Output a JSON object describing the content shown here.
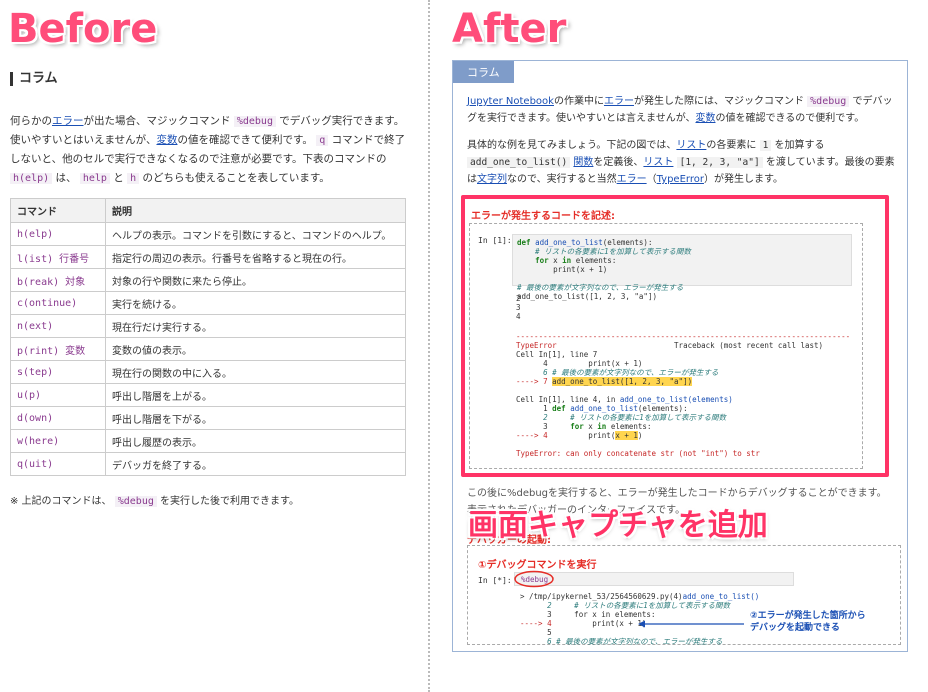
{
  "labels": {
    "before": "Before",
    "after": "After",
    "overlay": "画面キャプチャを追加"
  },
  "left": {
    "title": "コラム",
    "para1": {
      "t1": "何らかの",
      "l1": "エラー",
      "t2": "が出た場合、マジックコマンド ",
      "c1": "%debug",
      "t3": " でデバッグ実行できます。使いやすいとはいえませんが、",
      "l2": "変数",
      "t4": "の値を確認できて便利です。 ",
      "c2": "q",
      "t5": " コマンドで終了しないと、他のセルで実行できなくなるので注意が必要です。下表のコマンドの ",
      "c3": "h(elp)",
      "t6": " は、 ",
      "c4": "help",
      "t7": " と ",
      "c5": "h",
      "t8": " のどちらも使えることを表しています。"
    },
    "table": {
      "headers": [
        "コマンド",
        "説明"
      ],
      "rows": [
        [
          "h(elp)",
          "ヘルプの表示。コマンドを引数にすると、コマンドのヘルプ。"
        ],
        [
          "l(ist) 行番号",
          "指定行の周辺の表示。行番号を省略すると現在の行。"
        ],
        [
          "b(reak) 対象",
          "対象の行や関数に来たら停止。"
        ],
        [
          "c(ontinue)",
          "実行を続ける。"
        ],
        [
          "n(ext)",
          "現在行だけ実行する。"
        ],
        [
          "p(rint) 変数",
          "変数の値の表示。"
        ],
        [
          "s(tep)",
          "現在行の関数の中に入る。"
        ],
        [
          "u(p)",
          "呼出し階層を上がる。"
        ],
        [
          "d(own)",
          "呼出し階層を下がる。"
        ],
        [
          "w(here)",
          "呼出し履歴の表示。"
        ],
        [
          "q(uit)",
          "デバッガを終了する。"
        ]
      ]
    },
    "note": {
      "t1": "※ 上記のコマンドは、 ",
      "c1": "%debug",
      "t2": " を実行した後で利用できます。"
    }
  },
  "right": {
    "tab": "コラム",
    "para1": {
      "l1": "Jupyter Notebook",
      "t1": "の作業中に",
      "l2": "エラー",
      "t2": "が発生した際には、マジックコマンド ",
      "c1": "%debug",
      "t3": " でデバッグを実行できます。使いやすいとは言えませんが、",
      "l3": "変数",
      "t4": "の値を確認できるので便利です。"
    },
    "para2": {
      "t1": "具体的な例を見てみましょう。下記の図では、",
      "l1": "リスト",
      "t2": "の各要素に ",
      "c1": "1",
      "t3": " を加算する ",
      "c2": "add_one_to_list()",
      "t4": " ",
      "l2": "関数",
      "t5": "を定義後、",
      "l3": "リスト",
      "t6": " ",
      "c3": "[1, 2, 3, \"a\"]",
      "t7": " を渡しています。最後の要素は",
      "l4": "文字列",
      "t8": "なので、実行すると当然",
      "l5": "エラー",
      "t9": "（",
      "l6": "TypeError",
      "t10": "）が発生します。"
    },
    "redbox_title": "エラーが発生するコードを記述:",
    "in1": "In [1]:",
    "code": {
      "l1a": "def ",
      "l1b": "add_one_to_list",
      "l1c": "(elements):",
      "l2": "    # リストの各要素に1を加算して表示する関数",
      "l3a": "    ",
      "l3b": "for",
      "l3c": " x ",
      "l3d": "in",
      "l3e": " elements:",
      "l4": "        print(x + 1)",
      "l6": "# 最後の要素が文字列なので、エラーが発生する",
      "l7": "add_one_to_list([1, 2, 3, \"a\"])"
    },
    "out": [
      "2",
      "3",
      "4"
    ],
    "tb": {
      "sep": "--------------------------------------------------------------------------",
      "type": "TypeError",
      "recent": "Traceback (most recent call last)",
      "cell1": "Cell In[1], line 7",
      "a4": "      4         print(x + 1)",
      "a6": "      6 # 最後の要素が文字列なので、エラーが発生する",
      "a7p": "----> 7 ",
      "a7h": "add_one_to_list([1, 2, 3, \"a\"])",
      "cell2a": "Cell In[1], line 4, in ",
      "cell2b": "add_one_to_list(elements)",
      "b1a": "      1 ",
      "b1b": "def ",
      "b1c": "add_one_to_list",
      "b1d": "(elements):",
      "b2": "      2     # リストの各要素に1を加算して表示する関数",
      "b3a": "      3     ",
      "b3b": "for",
      "b3c": " x ",
      "b3d": "in",
      "b3e": " elements:",
      "b4p": "----> 4         ",
      "b4a": "print(",
      "b4h": "x + 1",
      "b4b": ")",
      "msg": "TypeError: can only concatenate str (not \"int\") to str"
    },
    "para3": "この後に%debugを実行すると、エラーが発生したコードからデバッグすることができます。表示されたデバッガーのインターフェイスです。",
    "dbg_label": "デバッガーの起動:",
    "dbg_title": "①デバッグコマンドを実行",
    "in2": "In [*]:",
    "magic": "%debug",
    "dbg": {
      "l1a": "> /tmp/ipykernel_53/2564560629.py(4)",
      "l1b": "add_one_to_list()",
      "l2": "      2     # リストの各要素に1を加算して表示する関数",
      "l3": "      3     for x in elements:",
      "l4p": "----> 4 ",
      "l4": "        print(x + 1)",
      "l5": "      5",
      "l6": "      6 # 最後の要素が文字列なので、エラーが発生する"
    },
    "annot": "②エラーが発生した箇所から\nデバッグを起動できる"
  },
  "colors": {
    "accent_pink": "#ff3366",
    "link": "#1a4fb4",
    "tab_bg": "#7f9cc9"
  }
}
